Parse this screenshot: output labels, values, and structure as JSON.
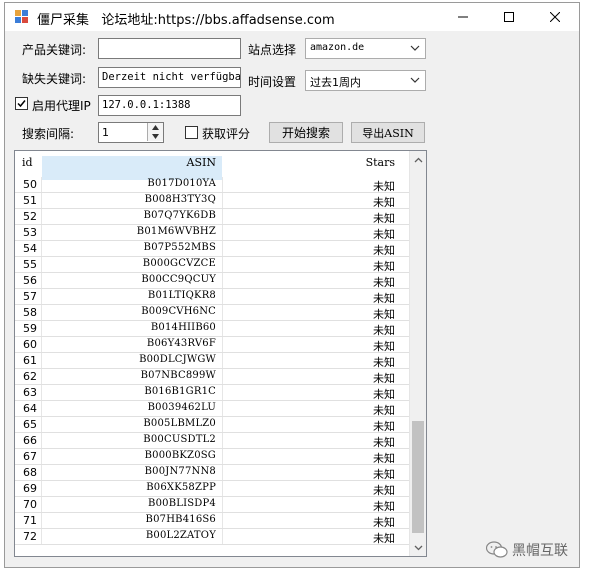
{
  "window": {
    "title": "僵尸采集   论坛地址:https://bbs.affadsense.com"
  },
  "form": {
    "keyword_label": "产品关键词:",
    "keyword_value": "",
    "missing_label": "缺失关键词:",
    "missing_value": "Derzeit nicht verfügbar",
    "proxy_label": "启用代理IP",
    "proxy_checked": true,
    "proxy_value": "127.0.0.1:1388",
    "interval_label": "搜索间隔:",
    "interval_value": "1",
    "site_label": "站点选择",
    "site_value": "amazon.de",
    "time_label": "时间设置",
    "time_value": "过去1周内",
    "rating_label": "获取评分",
    "rating_checked": false,
    "start_button": "开始搜索",
    "export_button": "导出ASIN"
  },
  "grid": {
    "columns": [
      "id",
      "ASIN",
      "Stars"
    ],
    "rows": [
      {
        "id": "50",
        "asin": "B017D010YA",
        "stars": "未知"
      },
      {
        "id": "51",
        "asin": "B008H3TY3Q",
        "stars": "未知"
      },
      {
        "id": "52",
        "asin": "B07Q7YK6DB",
        "stars": "未知"
      },
      {
        "id": "53",
        "asin": "B01M6WVBHZ",
        "stars": "未知"
      },
      {
        "id": "54",
        "asin": "B07P552MBS",
        "stars": "未知"
      },
      {
        "id": "55",
        "asin": "B000GCVZCE",
        "stars": "未知"
      },
      {
        "id": "56",
        "asin": "B00CC9QCUY",
        "stars": "未知"
      },
      {
        "id": "57",
        "asin": "B01LTIQKR8",
        "stars": "未知"
      },
      {
        "id": "58",
        "asin": "B009CVH6NC",
        "stars": "未知"
      },
      {
        "id": "59",
        "asin": "B014HIIB60",
        "stars": "未知"
      },
      {
        "id": "60",
        "asin": "B06Y43RV6F",
        "stars": "未知"
      },
      {
        "id": "61",
        "asin": "B00DLCJWGW",
        "stars": "未知"
      },
      {
        "id": "62",
        "asin": "B07NBC899W",
        "stars": "未知"
      },
      {
        "id": "63",
        "asin": "B016B1GR1C",
        "stars": "未知"
      },
      {
        "id": "64",
        "asin": "B0039462LU",
        "stars": "未知"
      },
      {
        "id": "65",
        "asin": "B005LBMLZ0",
        "stars": "未知"
      },
      {
        "id": "66",
        "asin": "B00CUSDTL2",
        "stars": "未知"
      },
      {
        "id": "67",
        "asin": "B000BKZ0SG",
        "stars": "未知"
      },
      {
        "id": "68",
        "asin": "B00JN77NN8",
        "stars": "未知"
      },
      {
        "id": "69",
        "asin": "B06XK58ZPP",
        "stars": "未知"
      },
      {
        "id": "70",
        "asin": "B00BLISDP4",
        "stars": "未知"
      },
      {
        "id": "71",
        "asin": "B07HB416S6",
        "stars": "未知"
      },
      {
        "id": "72",
        "asin": "B00L2ZATOY",
        "stars": "未知"
      }
    ]
  },
  "watermark": {
    "text": "黑帽互联"
  },
  "colors": {
    "selected_header": "#d9ebf9",
    "button_face": "#e1e1e1"
  },
  "icons": [
    "app-icon",
    "minimize-icon",
    "maximize-icon",
    "close-icon",
    "chevron-down-icon",
    "check-icon",
    "wechat-icon"
  ]
}
